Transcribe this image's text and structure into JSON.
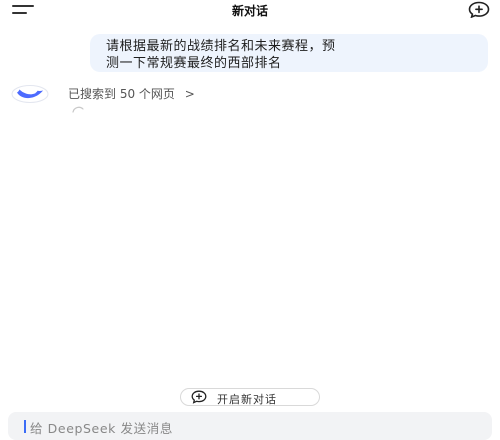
{
  "header": {
    "title": "新对话",
    "menu_icon": "hamburger-menu-icon",
    "new_chat_icon": "new-chat-icon"
  },
  "conversation": {
    "user_message_line1": "请根据最新的战绩排名和未来赛程，预",
    "user_message_line2": "测一下常规赛最终的西部排名",
    "assistant_avatar_icon": "deepseek-whale-icon",
    "search_status": "已搜索到 50 个网页",
    "search_chevron": ">"
  },
  "footer": {
    "new_chat_button_label": "开启新对话",
    "input_placeholder": "给 DeepSeek 发送消息"
  },
  "colors": {
    "accent": "#4d6bfe",
    "bubble": "#eef4fd",
    "input_bg": "#f2f3f5"
  }
}
